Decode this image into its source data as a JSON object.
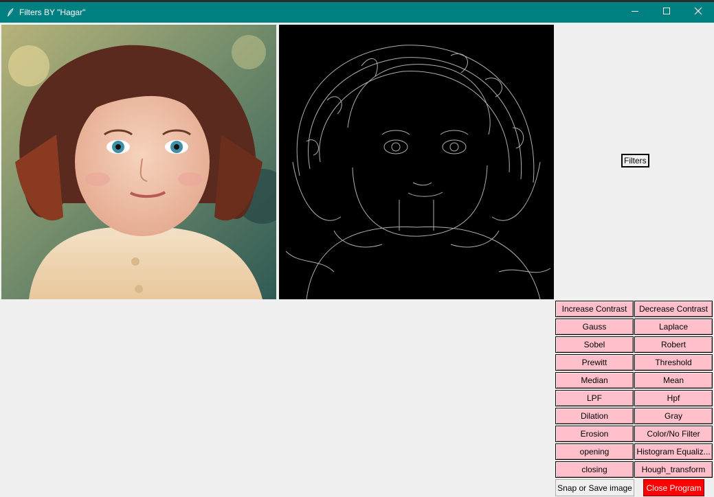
{
  "window": {
    "title": "Filters BY \"Hagar\"",
    "icon": "feather-icon",
    "title_bar_color": "#008080",
    "controls": [
      "minimize-icon",
      "maximize-icon",
      "close-icon"
    ]
  },
  "images": {
    "original": {
      "description_icon": "photo-image",
      "palette": [
        "#7c8a6c",
        "#5a2a1e",
        "#f0c8b0",
        "#efe0c8",
        "#2e4a3e"
      ]
    },
    "filtered": {
      "description_icon": "edge-detected-image",
      "background": "#000000",
      "edge_color": "#d0d0d0"
    }
  },
  "filters_label": "Filters",
  "buttons": {
    "color": "#ffc0cb",
    "rows": [
      [
        "Increase Contrast",
        "Decrease Contrast"
      ],
      [
        "Gauss",
        "Laplace"
      ],
      [
        "Sobel",
        "Robert"
      ],
      [
        "Prewitt",
        "Threshold"
      ],
      [
        "Median",
        "Mean"
      ],
      [
        "LPF",
        "Hpf"
      ],
      [
        "Dilation",
        "Gray"
      ],
      [
        "Erosion",
        "Color/No Filter"
      ],
      [
        "opening",
        "Histogram Equaliz..."
      ],
      [
        "closing",
        "Hough_transform"
      ]
    ]
  },
  "snap_button": "Snap or Save image",
  "close_program_button": "Close Program",
  "close_program_color": "#ff0000"
}
